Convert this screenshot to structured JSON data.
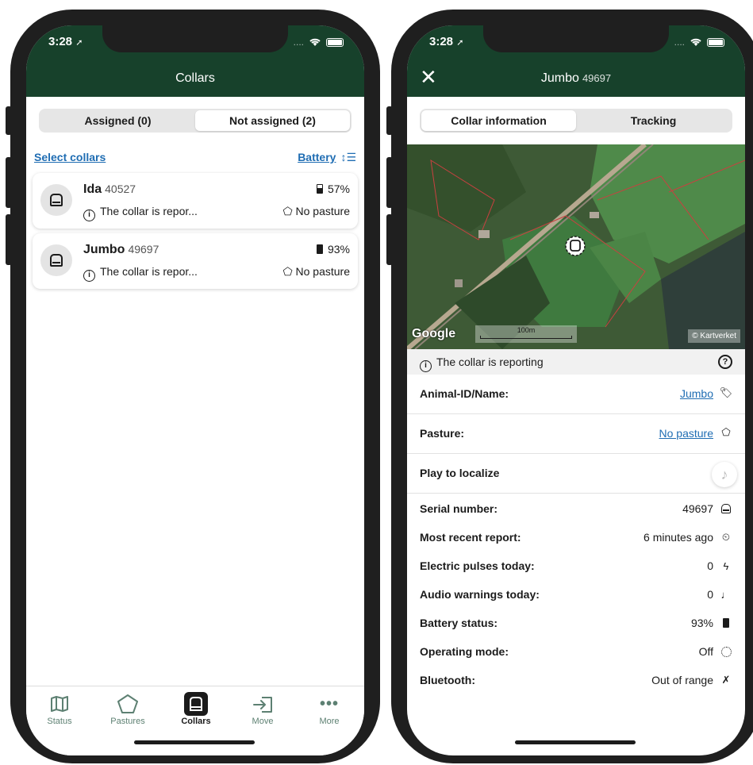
{
  "status_bar": {
    "time": "3:28",
    "signal": "....",
    "location_arrow": "location-arrow-icon"
  },
  "left": {
    "title": "Collars",
    "tabs": [
      {
        "label": "Assigned (0)"
      },
      {
        "label": "Not assigned (2)"
      }
    ],
    "active_tab": 1,
    "select_link": "Select collars",
    "sort_label": "Battery",
    "sort_icon": "sort-icon",
    "collars": [
      {
        "name": "Ida",
        "serial": "40527",
        "status": "The collar is repor...",
        "battery": "57%",
        "pasture": "No pasture"
      },
      {
        "name": "Jumbo",
        "serial": "49697",
        "status": "The collar is repor...",
        "battery": "93%",
        "pasture": "No pasture"
      }
    ],
    "tabbar": [
      {
        "label": "Status",
        "icon": "map-icon"
      },
      {
        "label": "Pastures",
        "icon": "pentagon-icon"
      },
      {
        "label": "Collars",
        "icon": "collar-icon"
      },
      {
        "label": "Move",
        "icon": "move-icon"
      },
      {
        "label": "More",
        "icon": "more-icon"
      }
    ],
    "active_nav": 2
  },
  "right": {
    "title_name": "Jumbo",
    "title_serial": "49697",
    "tabs": [
      {
        "label": "Collar information"
      },
      {
        "label": "Tracking"
      }
    ],
    "active_tab": 0,
    "map": {
      "attribution": "Google",
      "scale": "100m",
      "copyright": "© Kartverket"
    },
    "reporting": "The collar is reporting",
    "animal": {
      "label": "Animal-ID/Name:",
      "value": "Jumbo"
    },
    "pasture": {
      "label": "Pasture:",
      "value": "No pasture"
    },
    "play": {
      "label": "Play to localize"
    },
    "details": [
      {
        "label": "Serial number:",
        "value": "49697",
        "icon": "collar-icon"
      },
      {
        "label": "Most recent report:",
        "value": "6 minutes ago",
        "icon": "clock-icon"
      },
      {
        "label": "Electric pulses today:",
        "value": "0",
        "icon": "bolt-icon"
      },
      {
        "label": "Audio warnings today:",
        "value": "0",
        "icon": "music-note-icon"
      },
      {
        "label": "Battery status:",
        "value": "93%",
        "icon": "battery-icon"
      },
      {
        "label": "Operating mode:",
        "value": "Off",
        "icon": "dotted-circle-icon"
      },
      {
        "label": "Bluetooth:",
        "value": "Out of range",
        "icon": "bluetooth-off-icon"
      }
    ]
  },
  "colors": {
    "header": "#17412b",
    "link": "#1f6db3",
    "tab_inactive": "#5d8072"
  }
}
